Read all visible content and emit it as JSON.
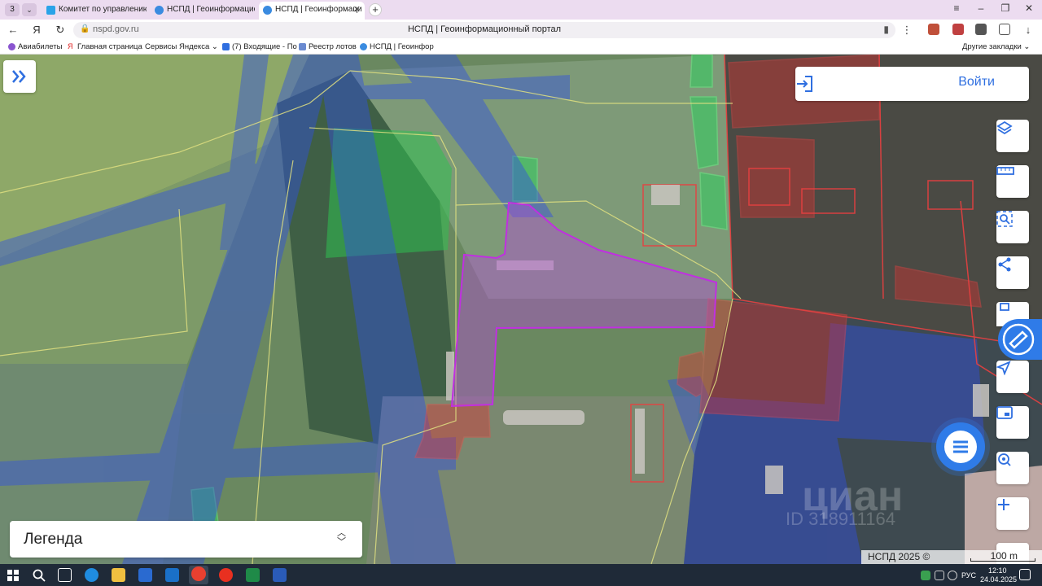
{
  "browser": {
    "tab_counter": "3",
    "tabs": [
      {
        "label": "Комитет по управлению"
      },
      {
        "label": "НСПД | Геоинформацио"
      },
      {
        "label": "НСПД | Геоинформаци"
      }
    ],
    "url": "nspd.gov.ru",
    "page_title": "НСПД | Геоинформационный портал",
    "bookmarks": [
      "Авиабилеты",
      "Главная страница",
      "Сервисы Яндекса",
      "(7) Входящие - По",
      "Реестр лотов",
      "НСПД | Геоинфор"
    ],
    "other_bookmarks": "Другие закладки"
  },
  "map": {
    "login_label": "Войти",
    "legend_label": "Легенда",
    "scale_label": "100 m",
    "attribution": "НСПД 2025 ©",
    "watermark": "циан",
    "watermark_id": "ID 318911164"
  },
  "taskbar": {
    "lang": "РУС",
    "time": "12:10",
    "date": "24.04.2025"
  },
  "colors": {
    "accent": "#2f7be8",
    "parcel_selected": "#b050d0",
    "zone_blue": "#3050e0",
    "zone_red": "#e03030",
    "zone_green": "#30d060"
  }
}
